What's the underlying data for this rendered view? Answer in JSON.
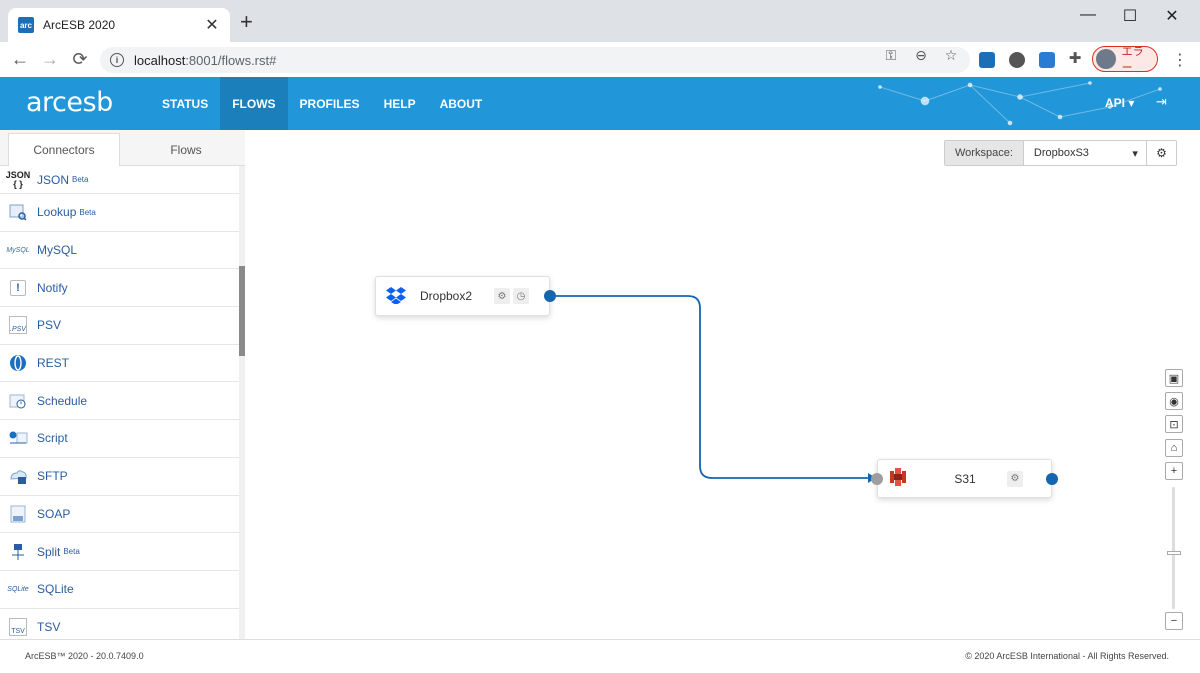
{
  "browser": {
    "tab_title": "ArcESB 2020",
    "favicon_text": "arc",
    "url_host": "localhost",
    "url_rest": ":8001/flows.rst#",
    "profile_label": "エラー"
  },
  "header": {
    "brand": "arcesb",
    "nav": [
      "STATUS",
      "FLOWS",
      "PROFILES",
      "HELP",
      "ABOUT"
    ],
    "active_nav": "FLOWS",
    "api_label": "API",
    "colors": {
      "header_bg": "#2196d8",
      "active_nav_bg": "#1b7fbc"
    }
  },
  "sidebar": {
    "tabs": [
      "Connectors",
      "Flows"
    ],
    "active_tab": "Connectors",
    "connectors": [
      {
        "label": "JSON",
        "badge": "Beta",
        "icon": "json-icon"
      },
      {
        "label": "Lookup",
        "badge": "Beta",
        "icon": "lookup-icon"
      },
      {
        "label": "MySQL",
        "badge": "",
        "icon": "mysql-icon"
      },
      {
        "label": "Notify",
        "badge": "",
        "icon": "notify-icon"
      },
      {
        "label": "PSV",
        "badge": "",
        "icon": "psv-icon"
      },
      {
        "label": "REST",
        "badge": "",
        "icon": "rest-icon"
      },
      {
        "label": "Schedule",
        "badge": "",
        "icon": "schedule-icon"
      },
      {
        "label": "Script",
        "badge": "",
        "icon": "script-icon"
      },
      {
        "label": "SFTP",
        "badge": "",
        "icon": "sftp-icon"
      },
      {
        "label": "SOAP",
        "badge": "",
        "icon": "soap-icon"
      },
      {
        "label": "Split",
        "badge": "Beta",
        "icon": "split-icon"
      },
      {
        "label": "SQLite",
        "badge": "",
        "icon": "sqlite-icon"
      },
      {
        "label": "TSV",
        "badge": "",
        "icon": "tsv-icon"
      }
    ]
  },
  "workspace": {
    "label": "Workspace:",
    "value": "DropboxS3"
  },
  "flow": {
    "nodes": [
      {
        "label": "Dropbox2",
        "icon": "dropbox-icon"
      },
      {
        "label": "S31",
        "icon": "s3-icon"
      }
    ]
  },
  "footer": {
    "version": "ArcESB™ 2020 - 20.0.7409.0",
    "copyright": "© 2020 ArcESB International - All Rights Reserved."
  }
}
